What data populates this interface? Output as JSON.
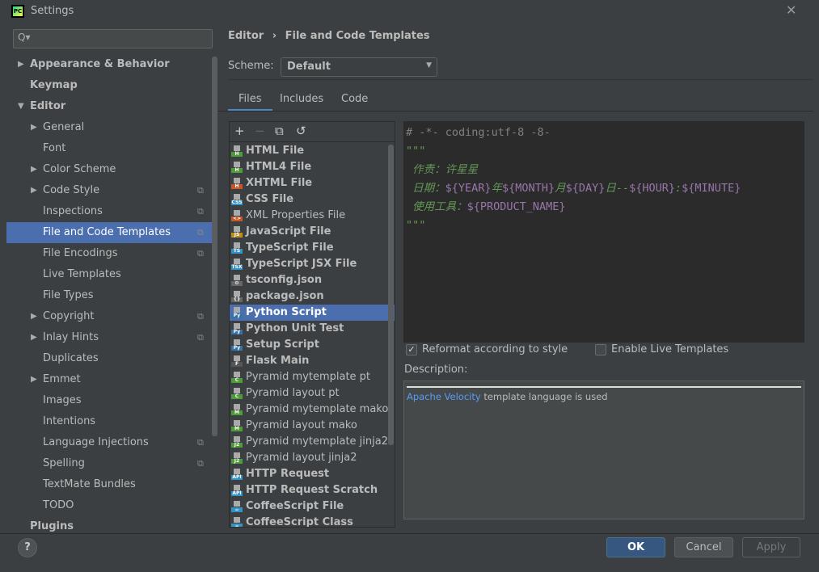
{
  "window": {
    "title": "Settings",
    "logo": "PC"
  },
  "search": {
    "placeholder": "Q▾"
  },
  "tree": [
    {
      "label": "Appearance & Behavior",
      "level": 0,
      "arrow": "right",
      "bold": true
    },
    {
      "label": "Keymap",
      "level": 0,
      "bold": true
    },
    {
      "label": "Editor",
      "level": 0,
      "arrow": "down",
      "bold": true
    },
    {
      "label": "General",
      "level": 1,
      "arrow": "right"
    },
    {
      "label": "Font",
      "level": 1
    },
    {
      "label": "Color Scheme",
      "level": 1,
      "arrow": "right"
    },
    {
      "label": "Code Style",
      "level": 1,
      "arrow": "right",
      "copy": true
    },
    {
      "label": "Inspections",
      "level": 1,
      "copy": true
    },
    {
      "label": "File and Code Templates",
      "level": 1,
      "copy": true,
      "selected": true
    },
    {
      "label": "File Encodings",
      "level": 1,
      "copy": true
    },
    {
      "label": "Live Templates",
      "level": 1
    },
    {
      "label": "File Types",
      "level": 1
    },
    {
      "label": "Copyright",
      "level": 1,
      "arrow": "right",
      "copy": true
    },
    {
      "label": "Inlay Hints",
      "level": 1,
      "arrow": "right",
      "copy": true
    },
    {
      "label": "Duplicates",
      "level": 1
    },
    {
      "label": "Emmet",
      "level": 1,
      "arrow": "right"
    },
    {
      "label": "Images",
      "level": 1
    },
    {
      "label": "Intentions",
      "level": 1
    },
    {
      "label": "Language Injections",
      "level": 1,
      "copy": true
    },
    {
      "label": "Spelling",
      "level": 1,
      "copy": true
    },
    {
      "label": "TextMate Bundles",
      "level": 1
    },
    {
      "label": "TODO",
      "level": 1
    },
    {
      "label": "Plugins",
      "level": 0,
      "bold": true
    }
  ],
  "breadcrumb": {
    "parent": "Editor",
    "sep": "›",
    "current": "File and Code Templates"
  },
  "scheme": {
    "label": "Scheme:",
    "value": "Default"
  },
  "tabs": [
    {
      "label": "Files",
      "active": true
    },
    {
      "label": "Includes"
    },
    {
      "label": "Code"
    }
  ],
  "toolbar": {
    "add": "+",
    "remove": "−",
    "copy": "⧉",
    "reset": "↺"
  },
  "files": [
    {
      "name": "HTML File",
      "bold": true,
      "badge": "H",
      "color": "#4f9a3a"
    },
    {
      "name": "HTML4 File",
      "bold": true,
      "badge": "H",
      "color": "#4f9a3a"
    },
    {
      "name": "XHTML File",
      "bold": true,
      "badge": "H",
      "color": "#c7572a"
    },
    {
      "name": "CSS File",
      "bold": true,
      "badge": "CSS",
      "color": "#3592c4"
    },
    {
      "name": "XML Properties File",
      "bold": false,
      "badge": "<>",
      "color": "#c7572a"
    },
    {
      "name": "JavaScript File",
      "bold": true,
      "badge": "JS",
      "color": "#b68f1d"
    },
    {
      "name": "TypeScript File",
      "bold": true,
      "badge": "TS",
      "color": "#3592c4"
    },
    {
      "name": "TypeScript JSX File",
      "bold": true,
      "badge": "TSX",
      "color": "#3592c4"
    },
    {
      "name": "tsconfig.json",
      "bold": true,
      "badge": "⚙",
      "color": "#666"
    },
    {
      "name": "package.json",
      "bold": true,
      "badge": "{}",
      "color": "#666"
    },
    {
      "name": "Python Script",
      "bold": true,
      "badge": "Py",
      "color": "#3572a5",
      "selected": true
    },
    {
      "name": "Python Unit Test",
      "bold": true,
      "badge": "Py",
      "color": "#3572a5"
    },
    {
      "name": "Setup Script",
      "bold": true,
      "badge": "Py",
      "color": "#3572a5"
    },
    {
      "name": "Flask Main",
      "bold": true,
      "badge": "F",
      "color": "#555"
    },
    {
      "name": "Pyramid mytemplate pt",
      "bold": false,
      "badge": "C",
      "color": "#4f9a3a"
    },
    {
      "name": "Pyramid layout pt",
      "bold": false,
      "badge": "C",
      "color": "#4f9a3a"
    },
    {
      "name": "Pyramid mytemplate mako",
      "bold": false,
      "badge": "M",
      "color": "#4f9a3a"
    },
    {
      "name": "Pyramid layout mako",
      "bold": false,
      "badge": "M",
      "color": "#4f9a3a"
    },
    {
      "name": "Pyramid mytemplate jinja2",
      "bold": false,
      "badge": "J2",
      "color": "#4f9a3a"
    },
    {
      "name": "Pyramid layout jinja2",
      "bold": false,
      "badge": "J2",
      "color": "#4f9a3a"
    },
    {
      "name": "HTTP Request",
      "bold": true,
      "badge": "API",
      "color": "#3592c4"
    },
    {
      "name": "HTTP Request Scratch",
      "bold": true,
      "badge": "API",
      "color": "#3592c4"
    },
    {
      "name": "CoffeeScript File",
      "bold": true,
      "badge": "☕",
      "color": "#3592c4"
    },
    {
      "name": "CoffeeScript Class",
      "bold": true,
      "badge": "☕",
      "color": "#3592c4"
    }
  ],
  "editor": {
    "lines": [
      [
        {
          "t": "# -*- coding:utf-8 -8-",
          "c": "gray"
        }
      ],
      [
        {
          "t": "\"\"\"",
          "c": "green"
        }
      ],
      [
        {
          "t": " 作责：许星星",
          "c": "green"
        }
      ],
      [
        {
          "t": " 日期：",
          "c": "green"
        },
        {
          "t": "${YEAR}",
          "c": "var"
        },
        {
          "t": "年",
          "c": "green"
        },
        {
          "t": "${MONTH}",
          "c": "var"
        },
        {
          "t": "月",
          "c": "green"
        },
        {
          "t": "${DAY}",
          "c": "var"
        },
        {
          "t": "日--",
          "c": "green"
        },
        {
          "t": "${HOUR}",
          "c": "var"
        },
        {
          "t": ":",
          "c": "green"
        },
        {
          "t": "${MINUTE}",
          "c": "var"
        }
      ],
      [
        {
          "t": " 使用工具：",
          "c": "green"
        },
        {
          "t": "${PRODUCT_NAME}",
          "c": "var"
        }
      ],
      [
        {
          "t": "\"\"\"",
          "c": "green"
        }
      ]
    ]
  },
  "options": {
    "reformat": {
      "label": "Reformat according to style",
      "checked": true
    },
    "live": {
      "label": "Enable Live Templates",
      "checked": false
    }
  },
  "description": {
    "label": "Description:",
    "link": "Apache Velocity",
    "text": " template language is used"
  },
  "footer": {
    "help": "?",
    "ok": "OK",
    "cancel": "Cancel",
    "apply": "Apply"
  },
  "colors": {
    "accent": "#4b6eaf",
    "ok": "#365880",
    "editor_bg": "#2b2b2b",
    "panel_bg": "#3c3f41"
  }
}
